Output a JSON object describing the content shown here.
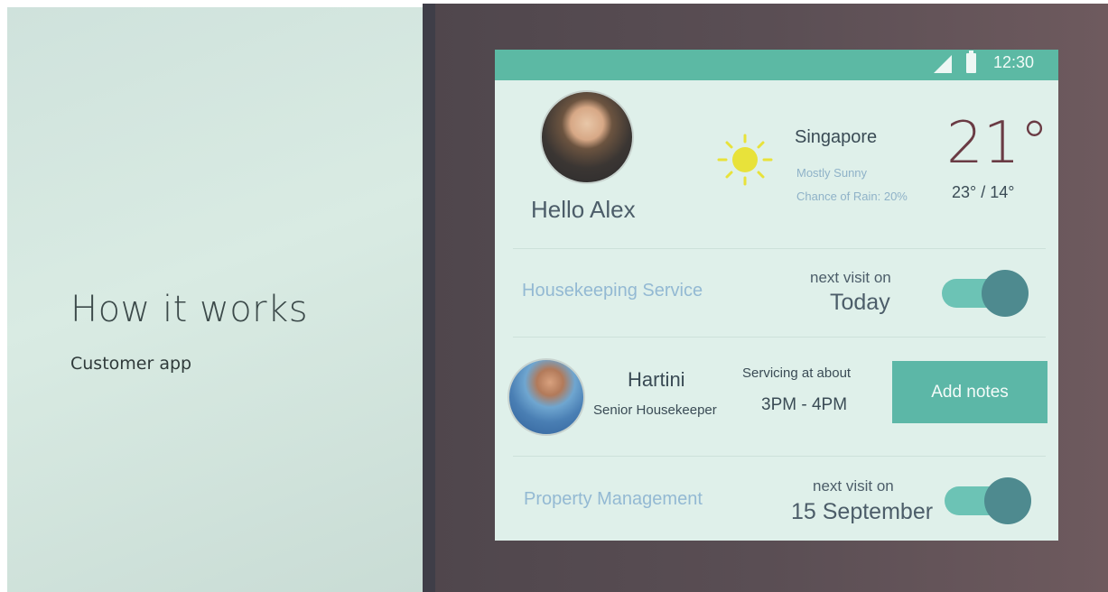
{
  "slide": {
    "title": "How it works",
    "subtitle": "Customer app"
  },
  "status_bar": {
    "time": "12:30",
    "icons": [
      "signal-icon",
      "battery-icon"
    ]
  },
  "greeting": {
    "text": "Hello Alex"
  },
  "weather": {
    "icon": "sun-icon",
    "city": "Singapore",
    "condition": "Mostly Sunny",
    "rain": "Chance of Rain: 20%",
    "temperature": "21°",
    "range": "23° / 14°"
  },
  "services": [
    {
      "label": "Housekeeping Service",
      "visit_caption": "next visit on",
      "visit_value": "Today",
      "enabled": true
    },
    {
      "label": "Property Management",
      "visit_caption": "next visit on",
      "visit_value": "15 September",
      "enabled": true
    }
  ],
  "housekeeper": {
    "name": "Hartini",
    "role": "Senior Housekeeper",
    "servicing_caption": "Servicing at about",
    "servicing_time": "3PM - 4PM",
    "button_label": "Add notes"
  },
  "colors": {
    "accent": "#5cb9a4",
    "toggle_knob": "#4e8a8f",
    "service_label": "#93b9d3",
    "temperature": "#6a3b44"
  }
}
